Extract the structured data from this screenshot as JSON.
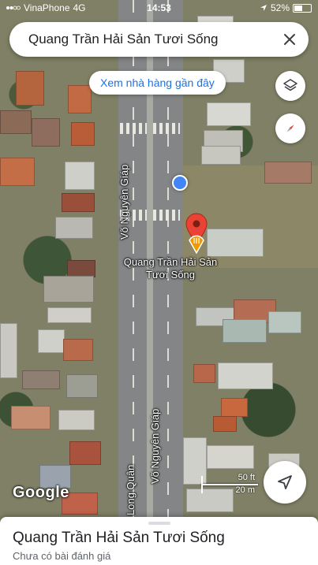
{
  "status_bar": {
    "carrier": "VinaPhone",
    "network": "4G",
    "time": "14:53",
    "battery": "52%",
    "battery_level": 0.52
  },
  "search": {
    "query": "Quang Trần Hải Sản Tươi Sống"
  },
  "map": {
    "chip_label": "Xem nhà hàng gần đây",
    "place_label": "Quang Trần Hải Sản Tươi Sống",
    "streets": [
      "Võ Nguyên Giáp",
      "Võ Nguyên Giáp",
      "Long Quân"
    ],
    "logo": "Google",
    "scale_top": "50 ft",
    "scale_bottom": "20 m"
  },
  "bottom_sheet": {
    "title": "Quang Trần Hải Sản Tươi Sống",
    "subtitle": "Chưa có bài đánh giá"
  },
  "colors": {
    "accent": "#1a73e8",
    "pin": "#ea4335",
    "location_dot": "#4285f4"
  },
  "icons": [
    "signal-icon",
    "wifi-icon",
    "location-arrow-icon",
    "close-icon",
    "layers-icon",
    "compass-icon",
    "navigate-icon",
    "place-pin-icon",
    "restaurant-icon"
  ]
}
